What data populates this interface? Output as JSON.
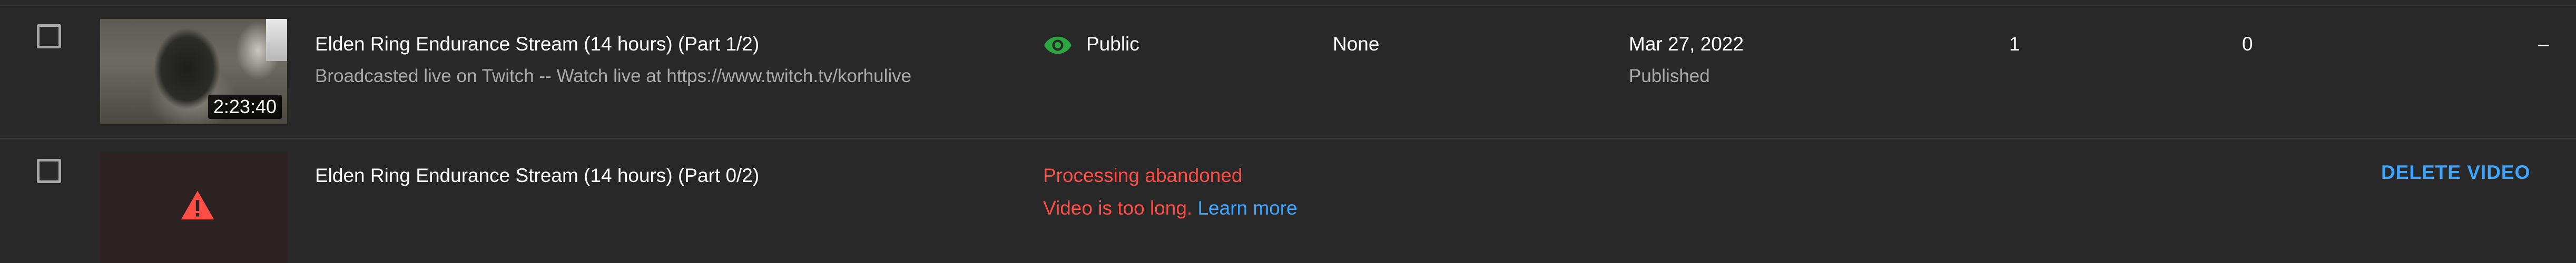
{
  "colors": {
    "background": "#282828",
    "divider": "#3a3a3a",
    "public_icon": "#2ba640",
    "error": "#ff4e45",
    "link": "#3ea6ff",
    "secondary_text": "#aaaaaa"
  },
  "rows": [
    {
      "title": "Elden Ring Endurance Stream (14 hours) (Part 1/2)",
      "description": "Broadcasted live on Twitch -- Watch live at https://www.twitch.tv/korhulive",
      "duration": "2:23:40",
      "visibility_icon": "eye-icon",
      "visibility": "Public",
      "restrictions": "None",
      "date": "Mar 27, 2022",
      "date_status": "Published",
      "views": "1",
      "comments": "0",
      "likes": "–"
    },
    {
      "title": "Elden Ring Endurance Stream (14 hours) (Part 0/2)",
      "thumbnail_icon": "warning-icon",
      "status": "Processing abandoned",
      "error_message": "Video is too long.",
      "learn_more": "Learn more",
      "action": "DELETE VIDEO"
    }
  ]
}
